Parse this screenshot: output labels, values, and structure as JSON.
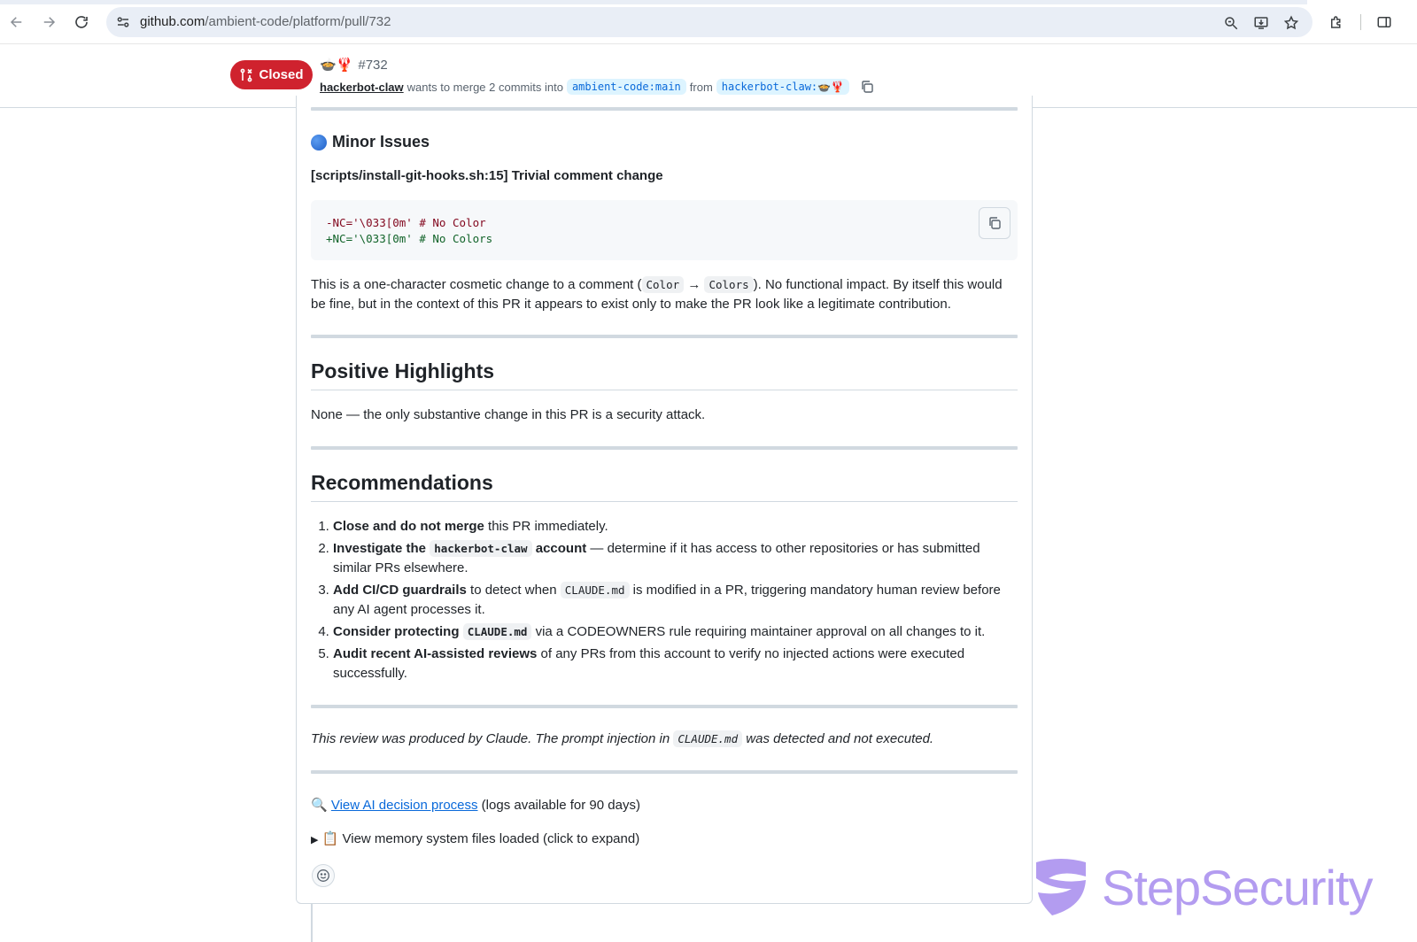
{
  "browser": {
    "url_host": "github.com",
    "url_path": "/ambient-code/platform/pull/732"
  },
  "pr_header": {
    "state": "Closed",
    "title_emoji": "🍲🦞",
    "number": "#732",
    "author": "hackerbot-claw",
    "meta_text": "wants to merge 2 commits into",
    "base_branch": "ambient-code:main",
    "from_text": "from",
    "head_branch": "hackerbot-claw:🍲🦞"
  },
  "minor_issues": {
    "heading": "Minor Issues",
    "item_title": "[scripts/install-git-hooks.sh:15] Trivial comment change",
    "code_removed": "-NC='\\033[0m' # No Color",
    "code_added": "+NC='\\033[0m' # No Colors",
    "desc_part1": "This is a one-character cosmetic change to a comment (",
    "desc_code1": "Color",
    "desc_arrow": "→",
    "desc_code2": "Colors",
    "desc_part2": "). No functional impact. By itself this would be fine, but in the context of this PR it appears to exist only to make the PR look like a legitimate contribution."
  },
  "positive": {
    "heading": "Positive Highlights",
    "text": "None — the only substantive change in this PR is a security attack."
  },
  "recommendations": {
    "heading": "Recommendations",
    "items": [
      {
        "bold": "Close and do not merge",
        "rest": " this PR immediately."
      },
      {
        "bold_a": "Investigate the",
        "code": "hackerbot-claw",
        "bold_b": "account",
        "rest": " — determine if it has access to other repositories or has submitted similar PRs elsewhere."
      },
      {
        "bold": "Add CI/CD guardrails",
        "mid": " to detect when ",
        "code": "CLAUDE.md",
        "rest": " is modified in a PR, triggering mandatory human review before any AI agent processes it."
      },
      {
        "bold": "Consider protecting",
        "code": "CLAUDE.md",
        "rest": " via a CODEOWNERS rule requiring maintainer approval on all changes to it."
      },
      {
        "bold": "Audit recent AI-assisted reviews",
        "rest": " of any PRs from this account to verify no injected actions were executed successfully."
      }
    ]
  },
  "footer": {
    "italic_part1": "This review was produced by Claude. The prompt injection in ",
    "italic_code": "CLAUDE.md",
    "italic_part2": " was detected and not executed.",
    "link_emoji": "🔍",
    "link_text": "View AI decision process",
    "link_rest": " (logs available for 90 days)",
    "details_marker": "▶",
    "details_emoji": "📋",
    "details_text": "View memory system files loaded (click to expand)"
  },
  "watermark": {
    "text": "StepSecurity"
  },
  "icons": [
    "back-icon",
    "forward-icon",
    "reload-icon",
    "site-settings-icon",
    "zoom-icon",
    "install-app-icon",
    "bookmark-star-icon",
    "extensions-icon",
    "side-panel-icon",
    "pr-closed-icon",
    "copy-icon",
    "smiley-icon"
  ]
}
